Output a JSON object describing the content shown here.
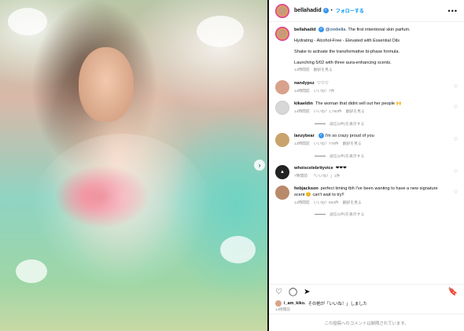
{
  "header": {
    "username": "bellahadid",
    "follow": "フォローする",
    "dot": "•",
    "more": "•••"
  },
  "caption": {
    "username": "bellahadid",
    "mention": "@orebella",
    "line1": ". The first intentional skin parfum.",
    "line2": "Hydrating - Alcohol-Free - Elevated with Essential Oils",
    "line3": "Shake to activate the transformative bi-phase formula.",
    "line4": "Launching 5/02 with three aura-enhancing scents.",
    "time": "14時間前",
    "translate": "翻訳を見る"
  },
  "comments": [
    {
      "username": "nandypsz",
      "text": "♡♡♡",
      "time": "14時間前",
      "likes": "いいね！7件",
      "verified": false
    },
    {
      "username": "kikaeldin",
      "text": "The woman that didnt sell out her people 🙌",
      "time": "14時間前",
      "likes": "いいね！1,760件",
      "translate": "翻訳を見る",
      "replies": "返信(2件)を表示する",
      "verified": false
    },
    {
      "username": "lanzybear",
      "text": "I'm so crazy proud of you",
      "time": "13時間前",
      "likes": "いいね！778件",
      "translate": "翻訳を見る",
      "replies": "返信(1件)を表示する",
      "verified": true
    },
    {
      "username": "whoiscelebrityvice",
      "text": "❤❤❤",
      "time": "7時間前",
      "likes": "「いいね！」1件",
      "verified": false
    },
    {
      "username": "hebjackson",
      "text": "perfect timing tbh I've been wanting to have a new signature scent 😊 can't wait to try!!",
      "time": "14時間前",
      "likes": "いいね！664件",
      "translate": "翻訳を見る",
      "replies": "返信(1件)を表示する",
      "verified": false
    }
  ],
  "likes_line": {
    "user": "i_am_kiko.",
    "rest": "その他が「いいね！」しました"
  },
  "post_date": "14時間前",
  "footer": "この投稿へのコメントは制限されています。",
  "icons": {
    "heart": "heart-icon",
    "comment": "comment-icon",
    "share": "share-icon",
    "save": "bookmark-icon"
  }
}
